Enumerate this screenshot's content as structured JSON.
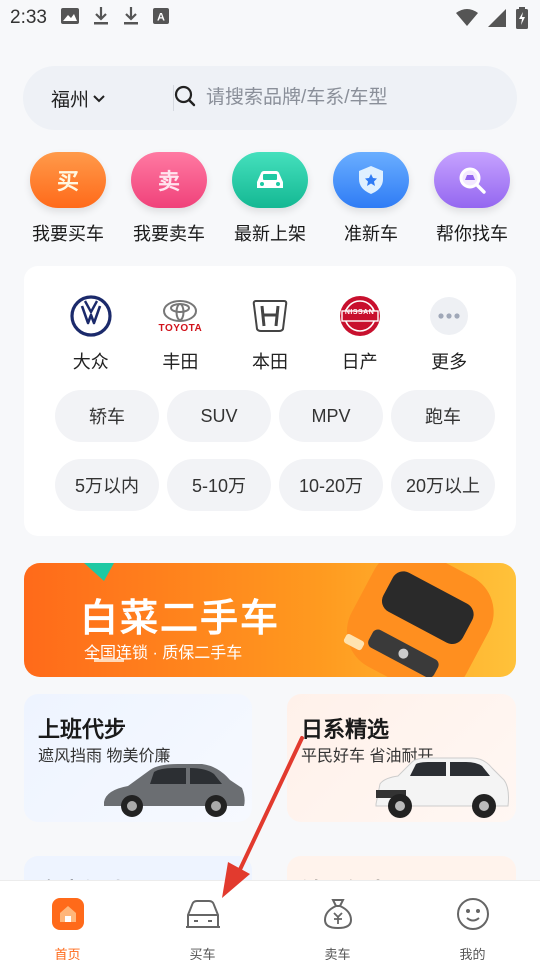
{
  "status_bar": {
    "time": "2:33",
    "icons": [
      "image-icon",
      "download-icon",
      "download-icon",
      "font-icon"
    ],
    "right_icons": [
      "wifi-icon",
      "signal-icon",
      "battery-charging-icon"
    ]
  },
  "search": {
    "city": "福州",
    "placeholder": "请搜索品牌/车系/车型"
  },
  "quick_entries": [
    {
      "label": "我要买车",
      "glyph": "买",
      "icon": "buy-car-icon",
      "color": "#ff7a2e"
    },
    {
      "label": "我要卖车",
      "glyph": "卖",
      "icon": "sell-car-icon",
      "color": "#f5457b"
    },
    {
      "label": "最新上架",
      "glyph": "",
      "icon": "new-car-icon",
      "color": "#1ec9a3"
    },
    {
      "label": "准新车",
      "glyph": "",
      "icon": "shield-icon",
      "color": "#3b8bff"
    },
    {
      "label": "帮你找车",
      "glyph": "",
      "icon": "find-car-icon",
      "color": "#a67cf7"
    }
  ],
  "brands": [
    {
      "name": "大众",
      "icon": "volkswagen-logo-icon"
    },
    {
      "name": "丰田",
      "icon": "toyota-logo-icon",
      "logo_text": "TOYOTA"
    },
    {
      "name": "本田",
      "icon": "honda-logo-icon"
    },
    {
      "name": "日产",
      "icon": "nissan-logo-icon",
      "logo_text": "NISSAN"
    },
    {
      "name": "更多",
      "icon": "more-icon"
    }
  ],
  "car_types": [
    "轿车",
    "SUV",
    "MPV",
    "跑车"
  ],
  "price_ranges": [
    "5万以内",
    "5-10万",
    "10-20万",
    "20万以上"
  ],
  "banner": {
    "title": "白菜二手车",
    "subtitle": "全国连锁 · 质保二手车"
  },
  "tiles": [
    {
      "title": "上班代步",
      "subtitle": "遮风挡雨 物美价廉"
    },
    {
      "title": "日系精选",
      "subtitle": "平民好车 省油耐开"
    },
    {
      "title": "家庭优选",
      "subtitle": ""
    },
    {
      "title": "销量领先",
      "subtitle": ""
    }
  ],
  "bottom_nav": [
    {
      "label": "首页",
      "icon": "home-icon",
      "active": true
    },
    {
      "label": "买车",
      "icon": "car-icon",
      "active": false
    },
    {
      "label": "卖车",
      "icon": "money-bag-icon",
      "active": false
    },
    {
      "label": "我的",
      "icon": "profile-icon",
      "active": false
    }
  ],
  "colors": {
    "accent": "#ff6a1a",
    "annotation_arrow": "#e23a2e"
  }
}
